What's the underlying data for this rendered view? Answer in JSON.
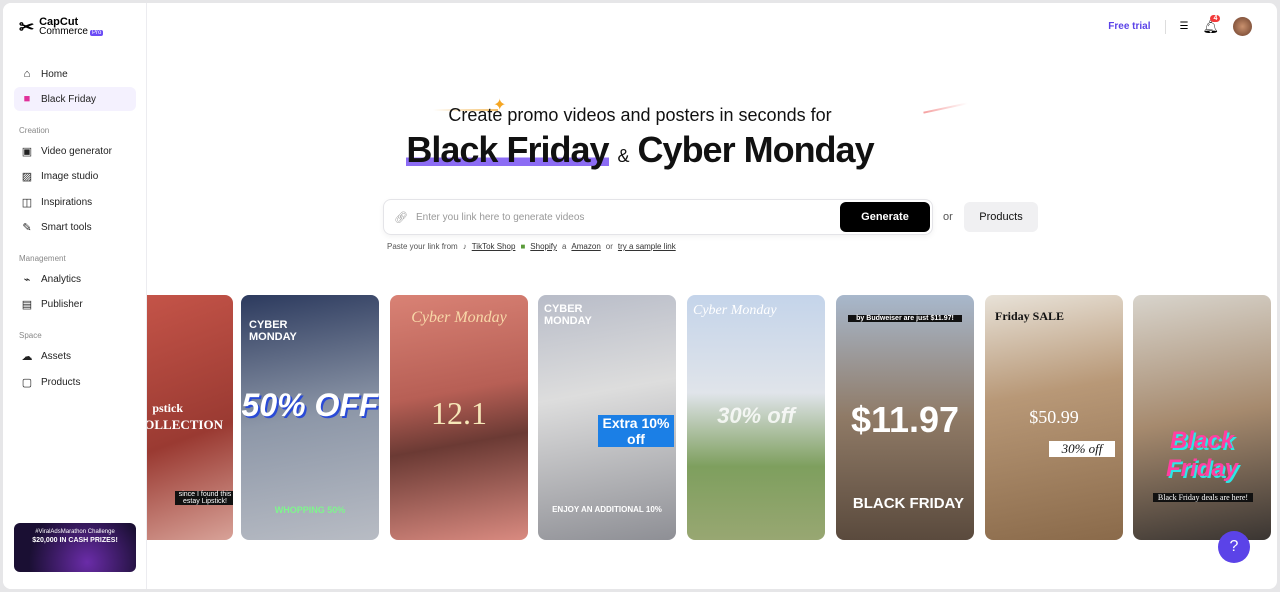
{
  "brand": {
    "line1": "CapCut",
    "line2": "Commerce",
    "tag": "Pro"
  },
  "sidebar": {
    "items": [
      {
        "label": "Home",
        "icon": "home-icon"
      },
      {
        "label": "Black Friday",
        "icon": "bag-icon"
      }
    ],
    "sections": [
      {
        "title": "Creation",
        "items": [
          {
            "label": "Video generator"
          },
          {
            "label": "Image studio"
          },
          {
            "label": "Inspirations"
          },
          {
            "label": "Smart tools"
          }
        ]
      },
      {
        "title": "Management",
        "items": [
          {
            "label": "Analytics"
          },
          {
            "label": "Publisher"
          }
        ]
      },
      {
        "title": "Space",
        "items": [
          {
            "label": "Assets"
          },
          {
            "label": "Products"
          }
        ]
      }
    ],
    "promo": {
      "line1": "#ViralAdsMarathon Challenge",
      "line2": "$20,000 IN CASH PRIZES!"
    }
  },
  "header": {
    "free_trial": "Free trial",
    "notifications": "4"
  },
  "hero": {
    "subtitle": "Create promo videos and posters in seconds for",
    "title_a": "Black Friday",
    "amp": "&",
    "title_b": "Cyber Monday"
  },
  "search": {
    "placeholder": "Enter you link here to generate videos",
    "generate": "Generate",
    "or": "or",
    "products": "Products",
    "paste_prefix": "Paste your link from",
    "tiktok": "TikTok Shop",
    "shopify": "Shopify",
    "amazon": "Amazon",
    "or2": "or",
    "sample": "try a sample link"
  },
  "cards": [
    {
      "a": "pstick",
      "b": "OLLECTION",
      "c": "since I found this estay Lipstick!"
    },
    {
      "a": "CYBER MONDAY",
      "b": "50% OFF",
      "c": "WHOPPING 50%"
    },
    {
      "a": "Cyber Monday",
      "b": "12.1",
      "c": ""
    },
    {
      "a": "CYBER MONDAY",
      "b": "Extra 10% off",
      "c": "ENJOY AN ADDITIONAL 10%"
    },
    {
      "a": "Cyber Monday",
      "b": "30% off",
      "c": ""
    },
    {
      "a": "by Budweiser are just $11.97!",
      "b": "$11.97",
      "c": "BLACK FRIDAY"
    },
    {
      "a": "Friday SALE",
      "b": "$50.99",
      "c": "30% off"
    },
    {
      "a": "Black Friday",
      "b": "",
      "c": "Black Friday deals are here!"
    }
  ]
}
